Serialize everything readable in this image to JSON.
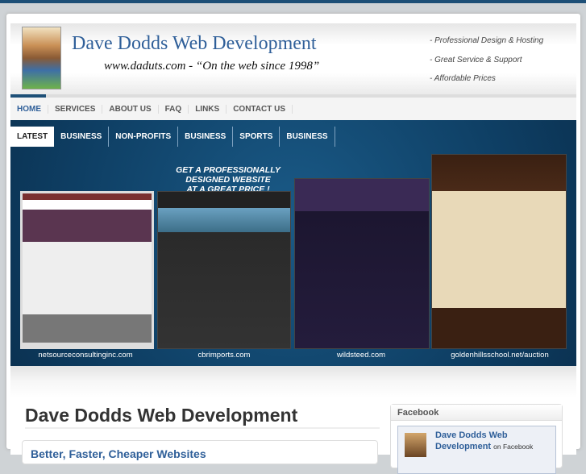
{
  "header": {
    "title": "Dave Dodds Web Development",
    "tagline": "www.daduts.com - “On the web since 1998”",
    "bullets": [
      "- Professional Design & Hosting",
      "- Great Service & Support",
      "- Affordable Prices"
    ]
  },
  "nav": [
    "HOME",
    "SERVICES",
    "ABOUT US",
    "FAQ",
    "LINKS",
    "CONTACT US"
  ],
  "slider": {
    "tabs": [
      "LATEST",
      "BUSINESS",
      "NON-PROFITS",
      "BUSINESS",
      "SPORTS",
      "BUSINESS"
    ],
    "promo": [
      "GET A PROFESSIONALLY",
      "DESIGNED WEBSITE",
      "AT A GREAT PRICE !"
    ],
    "shots": [
      "netsourceconsultinginc.com",
      "cbrimports.com",
      "wildsteed.com",
      "goldenhillsschool.net/auction"
    ]
  },
  "main": {
    "title": "Dave Dodds Web Development",
    "post_title": "Better, Faster, Cheaper Websites"
  },
  "facebook": {
    "heading": "Facebook",
    "page_name": "Dave Dodds Web Development",
    "suffix": "on Facebook"
  }
}
